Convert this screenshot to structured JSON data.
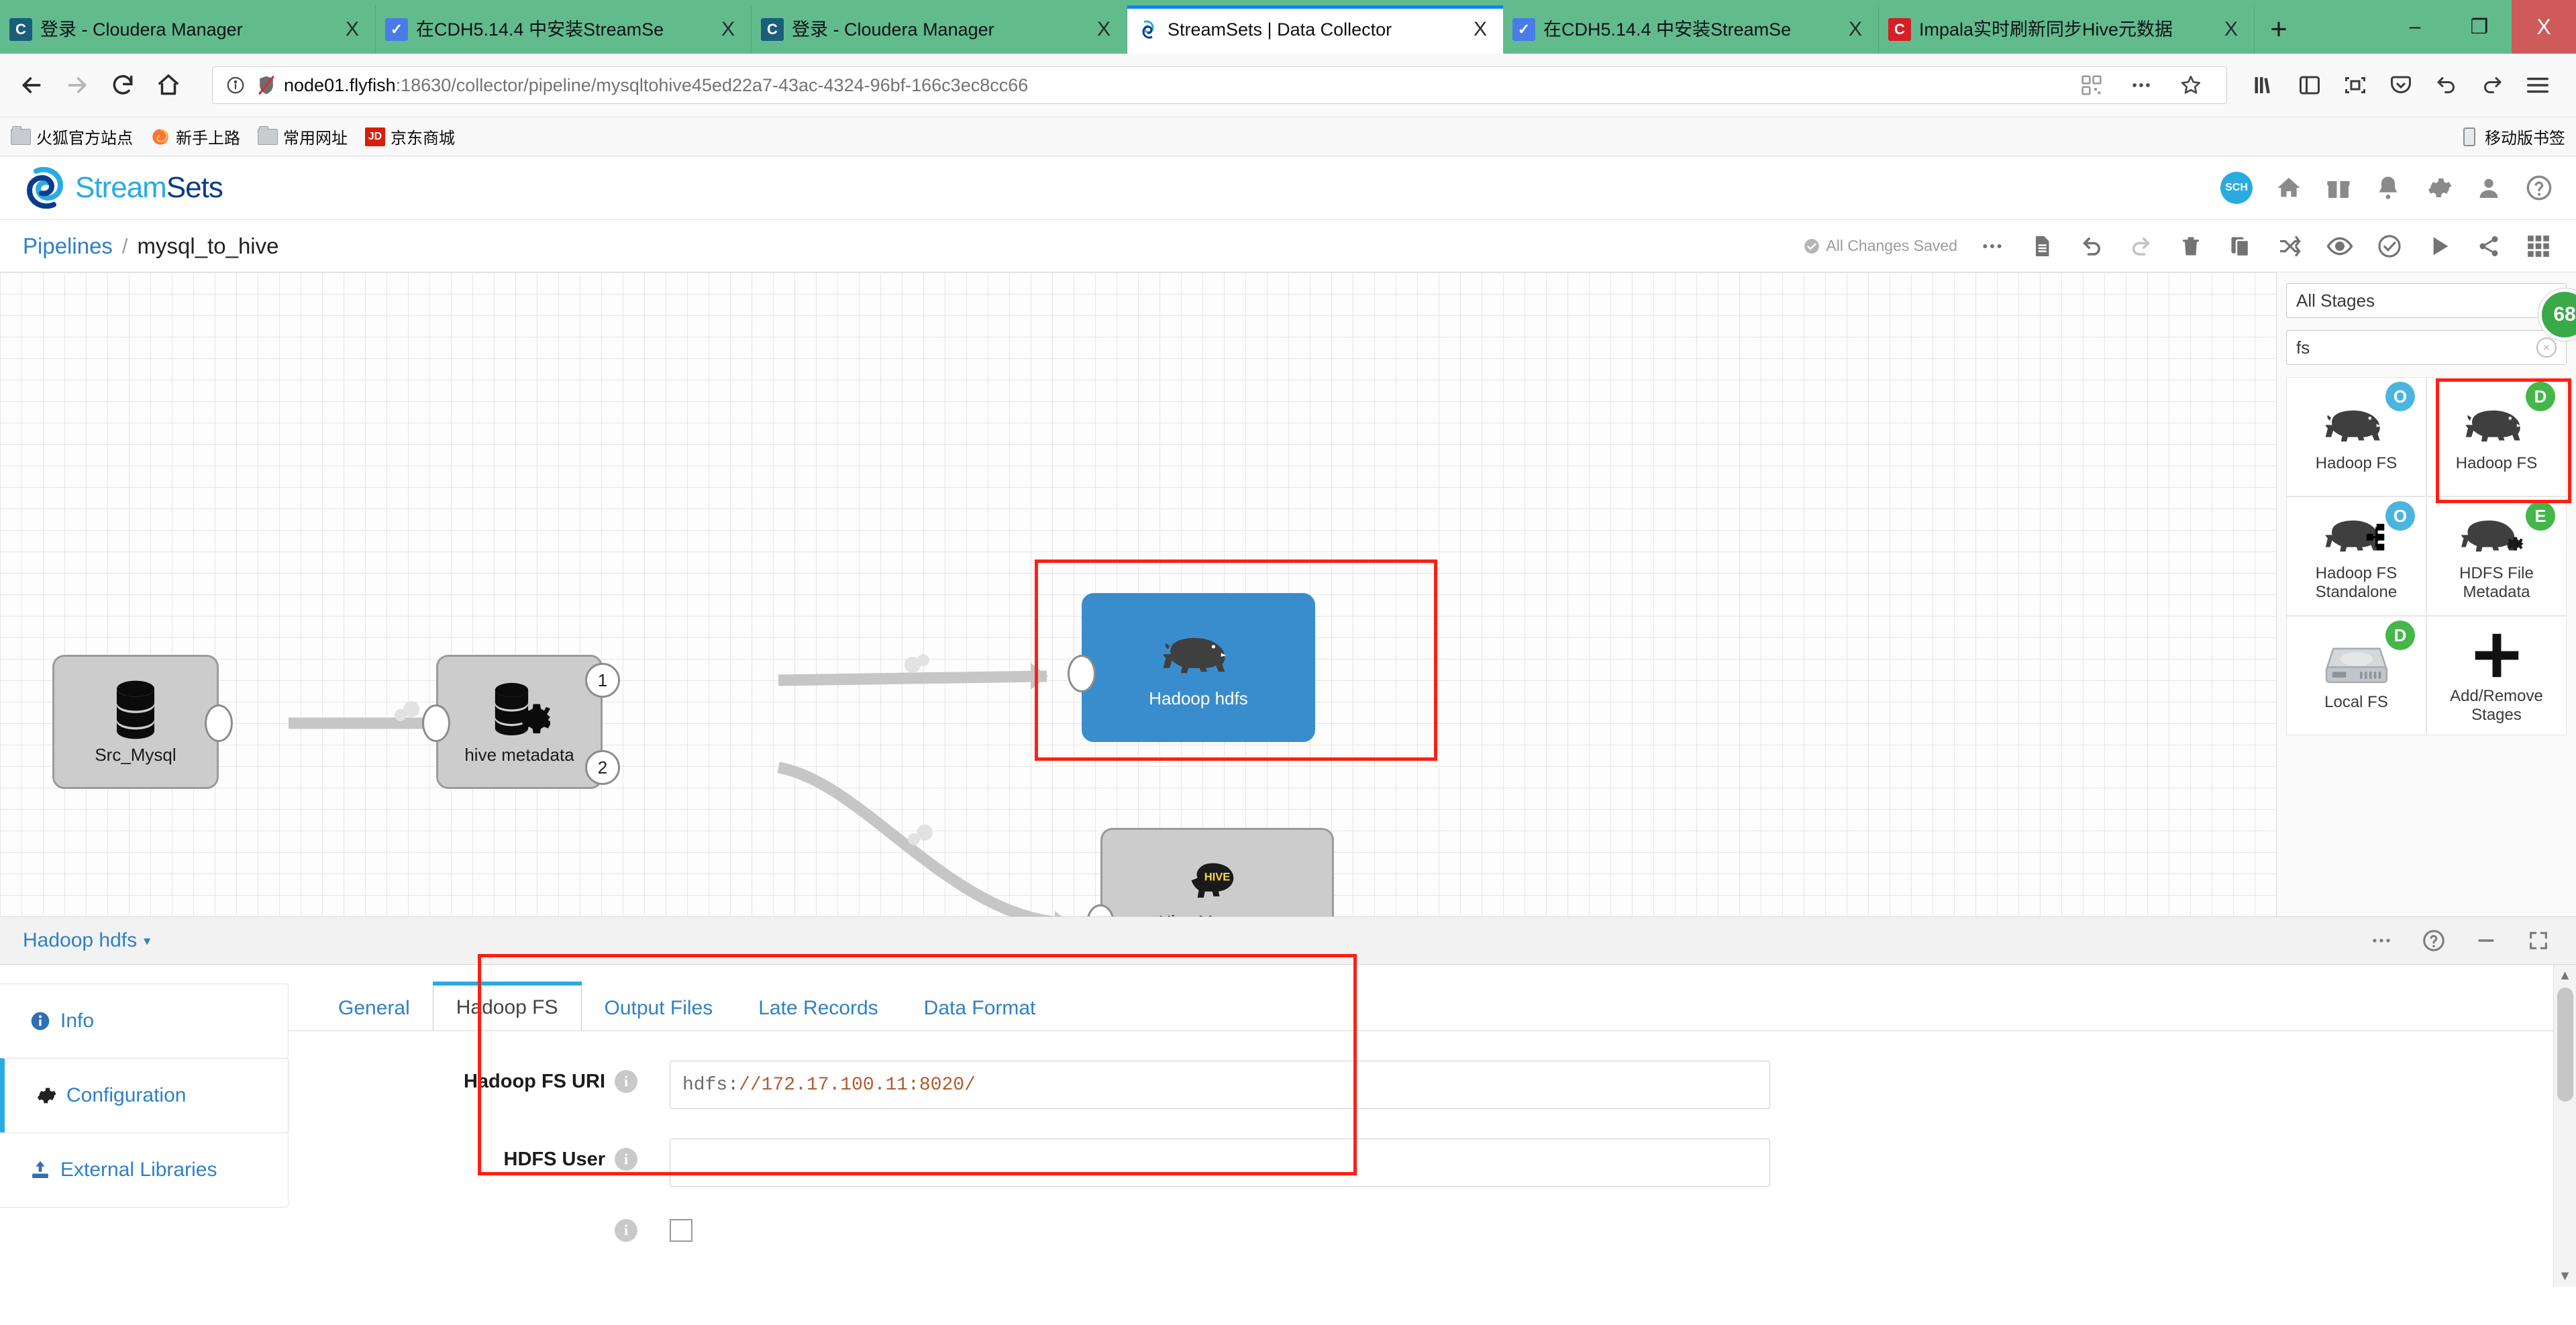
{
  "browser": {
    "tabs": [
      {
        "title": "登录 - Cloudera Manager",
        "favicon": "cloudera-icon",
        "active": false
      },
      {
        "title": "在CDH5.14.4 中安装StreamSe",
        "favicon": "cnblogs-icon",
        "active": false
      },
      {
        "title": "登录 - Cloudera Manager",
        "favicon": "cloudera-icon",
        "active": false
      },
      {
        "title": "StreamSets | Data Collector",
        "favicon": "streamsets-icon",
        "active": true
      },
      {
        "title": "在CDH5.14.4 中安装StreamSe",
        "favicon": "cnblogs-icon",
        "active": false
      },
      {
        "title": "Impala实时刷新同步Hive元数据",
        "favicon": "cloudera-red-icon",
        "active": false
      }
    ],
    "tab_close_label": "X",
    "new_tab_label": "+",
    "window_controls": {
      "minimize": "–",
      "restore": "❐",
      "close": "X"
    },
    "nav": {
      "back": "back-icon",
      "forward": "forward-icon",
      "reload": "reload-icon",
      "home": "home-icon"
    },
    "url": {
      "host": "node01.flyfish",
      "rest": ":18630/collector/pipeline/mysqltohive45ed22a7-43ac-4324-96bf-166c3ec8cc66",
      "full": "node01.flyfish:18630/collector/pipeline/mysqltohive45ed22a7-43ac-4324-96bf-166c3ec8cc66"
    },
    "bookmarks": [
      {
        "label": "火狐官方站点",
        "icon": "folder-icon"
      },
      {
        "label": "新手上路",
        "icon": "firefox-icon"
      },
      {
        "label": "常用网址",
        "icon": "folder-icon"
      },
      {
        "label": "京东商城",
        "icon": "jd-icon"
      }
    ],
    "bookmark_mobile": {
      "label": "移动版书签",
      "icon": "phone-icon"
    }
  },
  "app": {
    "logo": {
      "part1": "Stream",
      "part2": "Sets"
    },
    "header_badge": "SCH",
    "header_icons": [
      "home-icon",
      "gift-icon",
      "bell-icon",
      "gear-icon",
      "user-icon",
      "help-icon"
    ]
  },
  "toolbar": {
    "breadcrumb_root": "Pipelines",
    "breadcrumb_sep": "/",
    "pipeline_name": "mysql_to_hive",
    "save_status": "All Changes Saved",
    "icons": [
      "more-icon",
      "notes-icon",
      "undo-icon",
      "redo-icon",
      "delete-icon",
      "duplicate-icon",
      "shuffle-icon",
      "preview-icon",
      "validate-icon",
      "start-icon",
      "share-icon",
      "grid-icon"
    ]
  },
  "canvas": {
    "stages": [
      {
        "name": "Src_Mysql",
        "icon": "database-icon",
        "selected": false
      },
      {
        "name": "hive metadata",
        "icon": "database-gear-icon",
        "selected": false
      },
      {
        "name": "Hadoop hdfs",
        "icon": "hadoop-elephant-icon",
        "selected": true
      },
      {
        "name": "Hive Metastore",
        "icon": "hive-icon",
        "selected": false
      }
    ],
    "output_lane_labels": [
      "1",
      "2"
    ],
    "zoom_controls": {
      "zoom_in": "+",
      "zoom_out": "−"
    }
  },
  "stage_library": {
    "filter_value": "All Stages",
    "search_value": "fs",
    "search_clear": "×",
    "result_count": "68",
    "items": [
      {
        "label": "Hadoop FS",
        "badge": "O",
        "badge_type": "origin",
        "icon": "hadoop-elephant-icon",
        "highlighted": false
      },
      {
        "label": "Hadoop FS",
        "badge": "D",
        "badge_type": "destination",
        "icon": "hadoop-elephant-icon",
        "highlighted": true
      },
      {
        "label": "Hadoop FS Standalone",
        "badge": "O",
        "badge_type": "origin",
        "icon": "hadoop-elephant-tree-icon",
        "highlighted": false
      },
      {
        "label": "HDFS File Metadata",
        "badge": "E",
        "badge_type": "executor",
        "icon": "hadoop-elephant-gear-icon",
        "highlighted": false
      },
      {
        "label": "Local FS",
        "badge": "D",
        "badge_type": "destination",
        "icon": "harddrive-icon",
        "highlighted": false
      },
      {
        "label": "Add/Remove Stages",
        "badge": "",
        "badge_type": "",
        "icon": "plus-icon",
        "highlighted": false
      }
    ]
  },
  "properties_panel": {
    "title": "Hadoop hdfs",
    "title_caret": "▾",
    "header_icons": [
      "more-icon",
      "help-icon",
      "minimize-icon",
      "expand-icon"
    ],
    "side_items": [
      {
        "label": "Info",
        "icon": "info-icon",
        "active": false
      },
      {
        "label": "Configuration",
        "icon": "gear-icon",
        "active": true
      },
      {
        "label": "External Libraries",
        "icon": "upload-icon",
        "active": false
      }
    ],
    "tabs": [
      {
        "label": "General",
        "active": false
      },
      {
        "label": "Hadoop FS",
        "active": true
      },
      {
        "label": "Output Files",
        "active": false
      },
      {
        "label": "Late Records",
        "active": false
      },
      {
        "label": "Data Format",
        "active": false
      }
    ],
    "fields": [
      {
        "label": "Hadoop FS URI",
        "value_proto": "hdfs:",
        "value_rest": "//172.17.100.11:8020/",
        "value": "hdfs://172.17.100.11:8020/",
        "type": "text",
        "info": "i"
      },
      {
        "label": "HDFS User",
        "value_proto": "",
        "value_rest": "",
        "value": "",
        "type": "text",
        "info": "i"
      },
      {
        "label": "",
        "value": "",
        "type": "checkbox",
        "info": "i"
      }
    ]
  },
  "colors": {
    "accent": "#29ABE2",
    "brand_dark": "#0B3C8C",
    "selected_stage": "#3a8dcc",
    "highlight_box": "#ff1f14",
    "badge_origin": "#4bb5e0",
    "badge_destination": "#45b649",
    "tab_bar": "#62bb8d"
  }
}
